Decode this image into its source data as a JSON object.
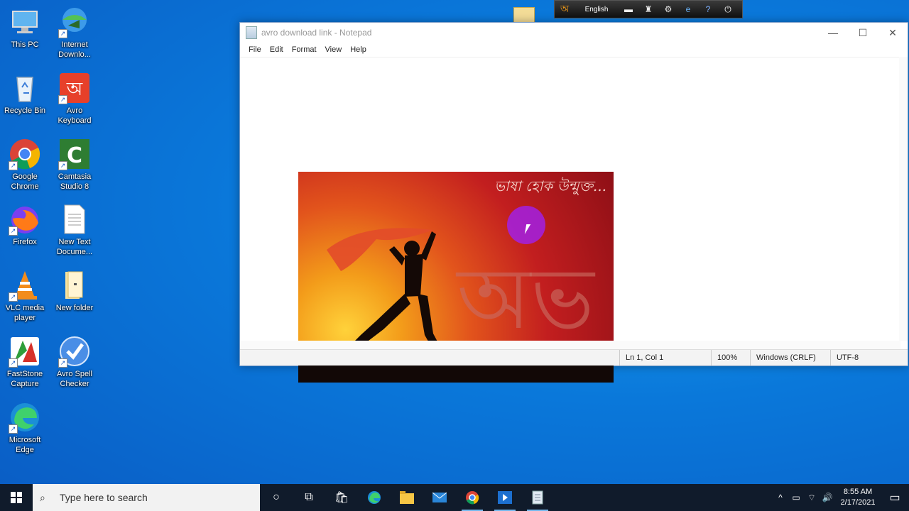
{
  "desktop": {
    "icons": [
      {
        "label": "This PC",
        "icon": "computer-icon"
      },
      {
        "label": "Internet Downlo...",
        "icon": "download-manager-icon"
      },
      {
        "label": "Recycle Bin",
        "icon": "recycle-bin-icon"
      },
      {
        "label": "Avro Keyboard",
        "icon": "avro-icon"
      },
      {
        "label": "Google Chrome",
        "icon": "chrome-icon"
      },
      {
        "label": "Camtasia Studio 8",
        "icon": "camtasia-icon"
      },
      {
        "label": "Firefox",
        "icon": "firefox-icon"
      },
      {
        "label": "New Text Docume...",
        "icon": "text-document-icon"
      },
      {
        "label": "VLC media player",
        "icon": "vlc-icon"
      },
      {
        "label": "New folder",
        "icon": "folder-icon"
      },
      {
        "label": "FastStone Capture",
        "icon": "faststone-icon"
      },
      {
        "label": "Avro Spell Checker",
        "icon": "spell-checker-icon"
      },
      {
        "label": "Microsoft Edge",
        "icon": "edge-icon"
      }
    ]
  },
  "avro_toolbar": {
    "language": "English",
    "buttons": [
      "avro-logo-icon",
      "keyboard-layout-icon",
      "mouse-icon",
      "settings-icon",
      "web-icon",
      "help-icon",
      "power-icon"
    ]
  },
  "notepad": {
    "title": "avro download link - Notepad",
    "menu": [
      "File",
      "Edit",
      "Format",
      "View",
      "Help"
    ],
    "image_tagline": "ভাষা হোক উন্মুক্ত...",
    "image_letters": "অভ",
    "status": {
      "position": "Ln 1, Col 1",
      "zoom": "100%",
      "line_ending": "Windows (CRLF)",
      "encoding": "UTF-8"
    }
  },
  "taskbar": {
    "search_placeholder": "Type here to search",
    "apps": [
      "cortana-icon",
      "task-view-icon",
      "store-icon",
      "edge-icon",
      "file-explorer-icon",
      "mail-icon",
      "chrome-icon",
      "media-icon",
      "notepad-icon"
    ],
    "clock": {
      "time": "8:55 AM",
      "date": "2/17/2021"
    }
  }
}
